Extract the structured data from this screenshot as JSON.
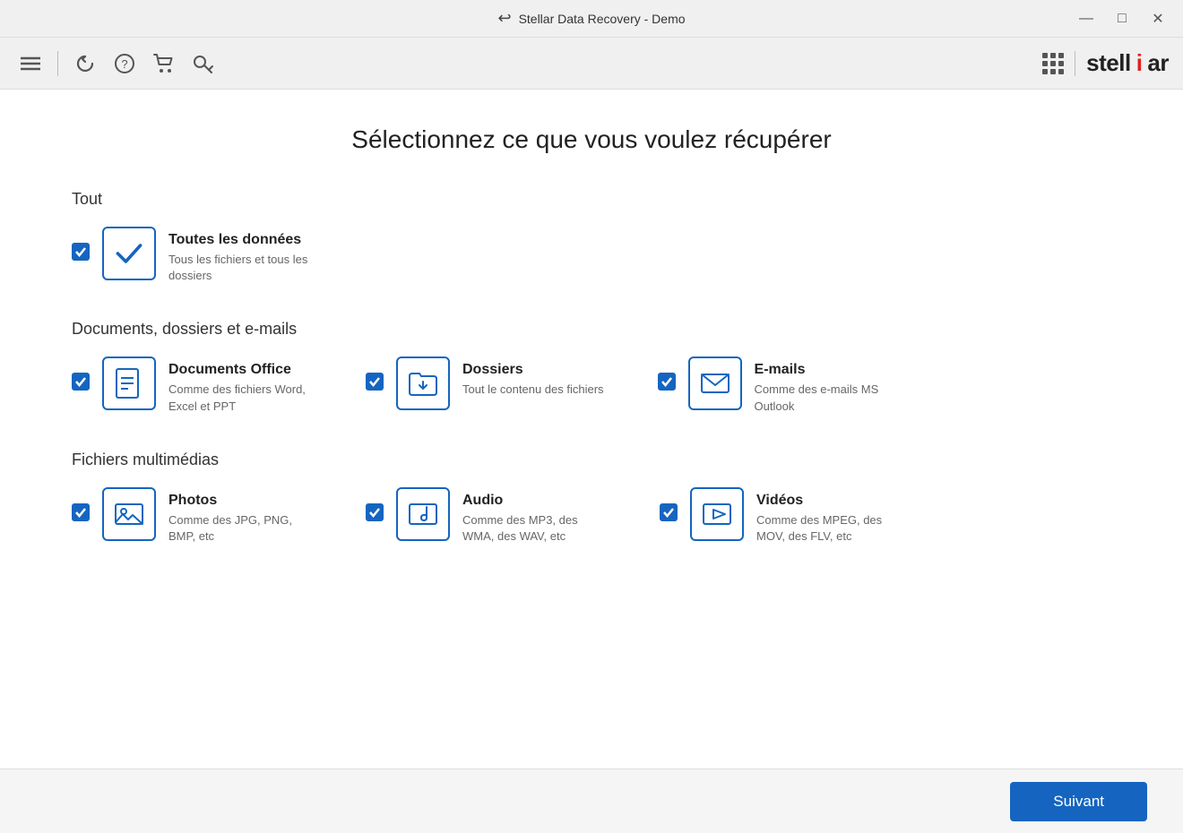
{
  "titleBar": {
    "title": "Stellar Data Recovery - Demo",
    "minimize": "—",
    "maximize": "□",
    "close": "✕"
  },
  "toolbar": {
    "menu_icon": "☰",
    "recover_icon": "↺",
    "help_icon": "?",
    "cart_icon": "🛒",
    "key_icon": "🔑",
    "logo": "stell",
    "logo_red": "i",
    "logo_end": "ar"
  },
  "page": {
    "title": "Sélectionnez ce que vous voulez récupérer"
  },
  "sections": [
    {
      "id": "tout",
      "title": "Tout",
      "items": [
        {
          "id": "toutes-donnees",
          "name": "Toutes les données",
          "desc": "Tous les fichiers et tous les dossiers",
          "checked": true,
          "icon_type": "checkmark"
        }
      ]
    },
    {
      "id": "documents",
      "title": "Documents, dossiers et e-mails",
      "items": [
        {
          "id": "documents-office",
          "name": "Documents Office",
          "desc": "Comme des fichiers Word, Excel et PPT",
          "checked": true,
          "icon_type": "document"
        },
        {
          "id": "dossiers",
          "name": "Dossiers",
          "desc": "Tout le contenu des fichiers",
          "checked": true,
          "icon_type": "folder"
        },
        {
          "id": "emails",
          "name": "E-mails",
          "desc": "Comme des e-mails MS Outlook",
          "checked": true,
          "icon_type": "email"
        }
      ]
    },
    {
      "id": "multimedia",
      "title": "Fichiers multimédias",
      "items": [
        {
          "id": "photos",
          "name": "Photos",
          "desc": "Comme des JPG, PNG, BMP, etc",
          "checked": true,
          "icon_type": "photo"
        },
        {
          "id": "audio",
          "name": "Audio",
          "desc": "Comme des MP3, des WMA, des WAV, etc",
          "checked": true,
          "icon_type": "audio"
        },
        {
          "id": "videos",
          "name": "Vidéos",
          "desc": "Comme des MPEG, des MOV, des FLV, etc",
          "checked": true,
          "icon_type": "video"
        }
      ]
    }
  ],
  "footer": {
    "next_label": "Suivant"
  }
}
